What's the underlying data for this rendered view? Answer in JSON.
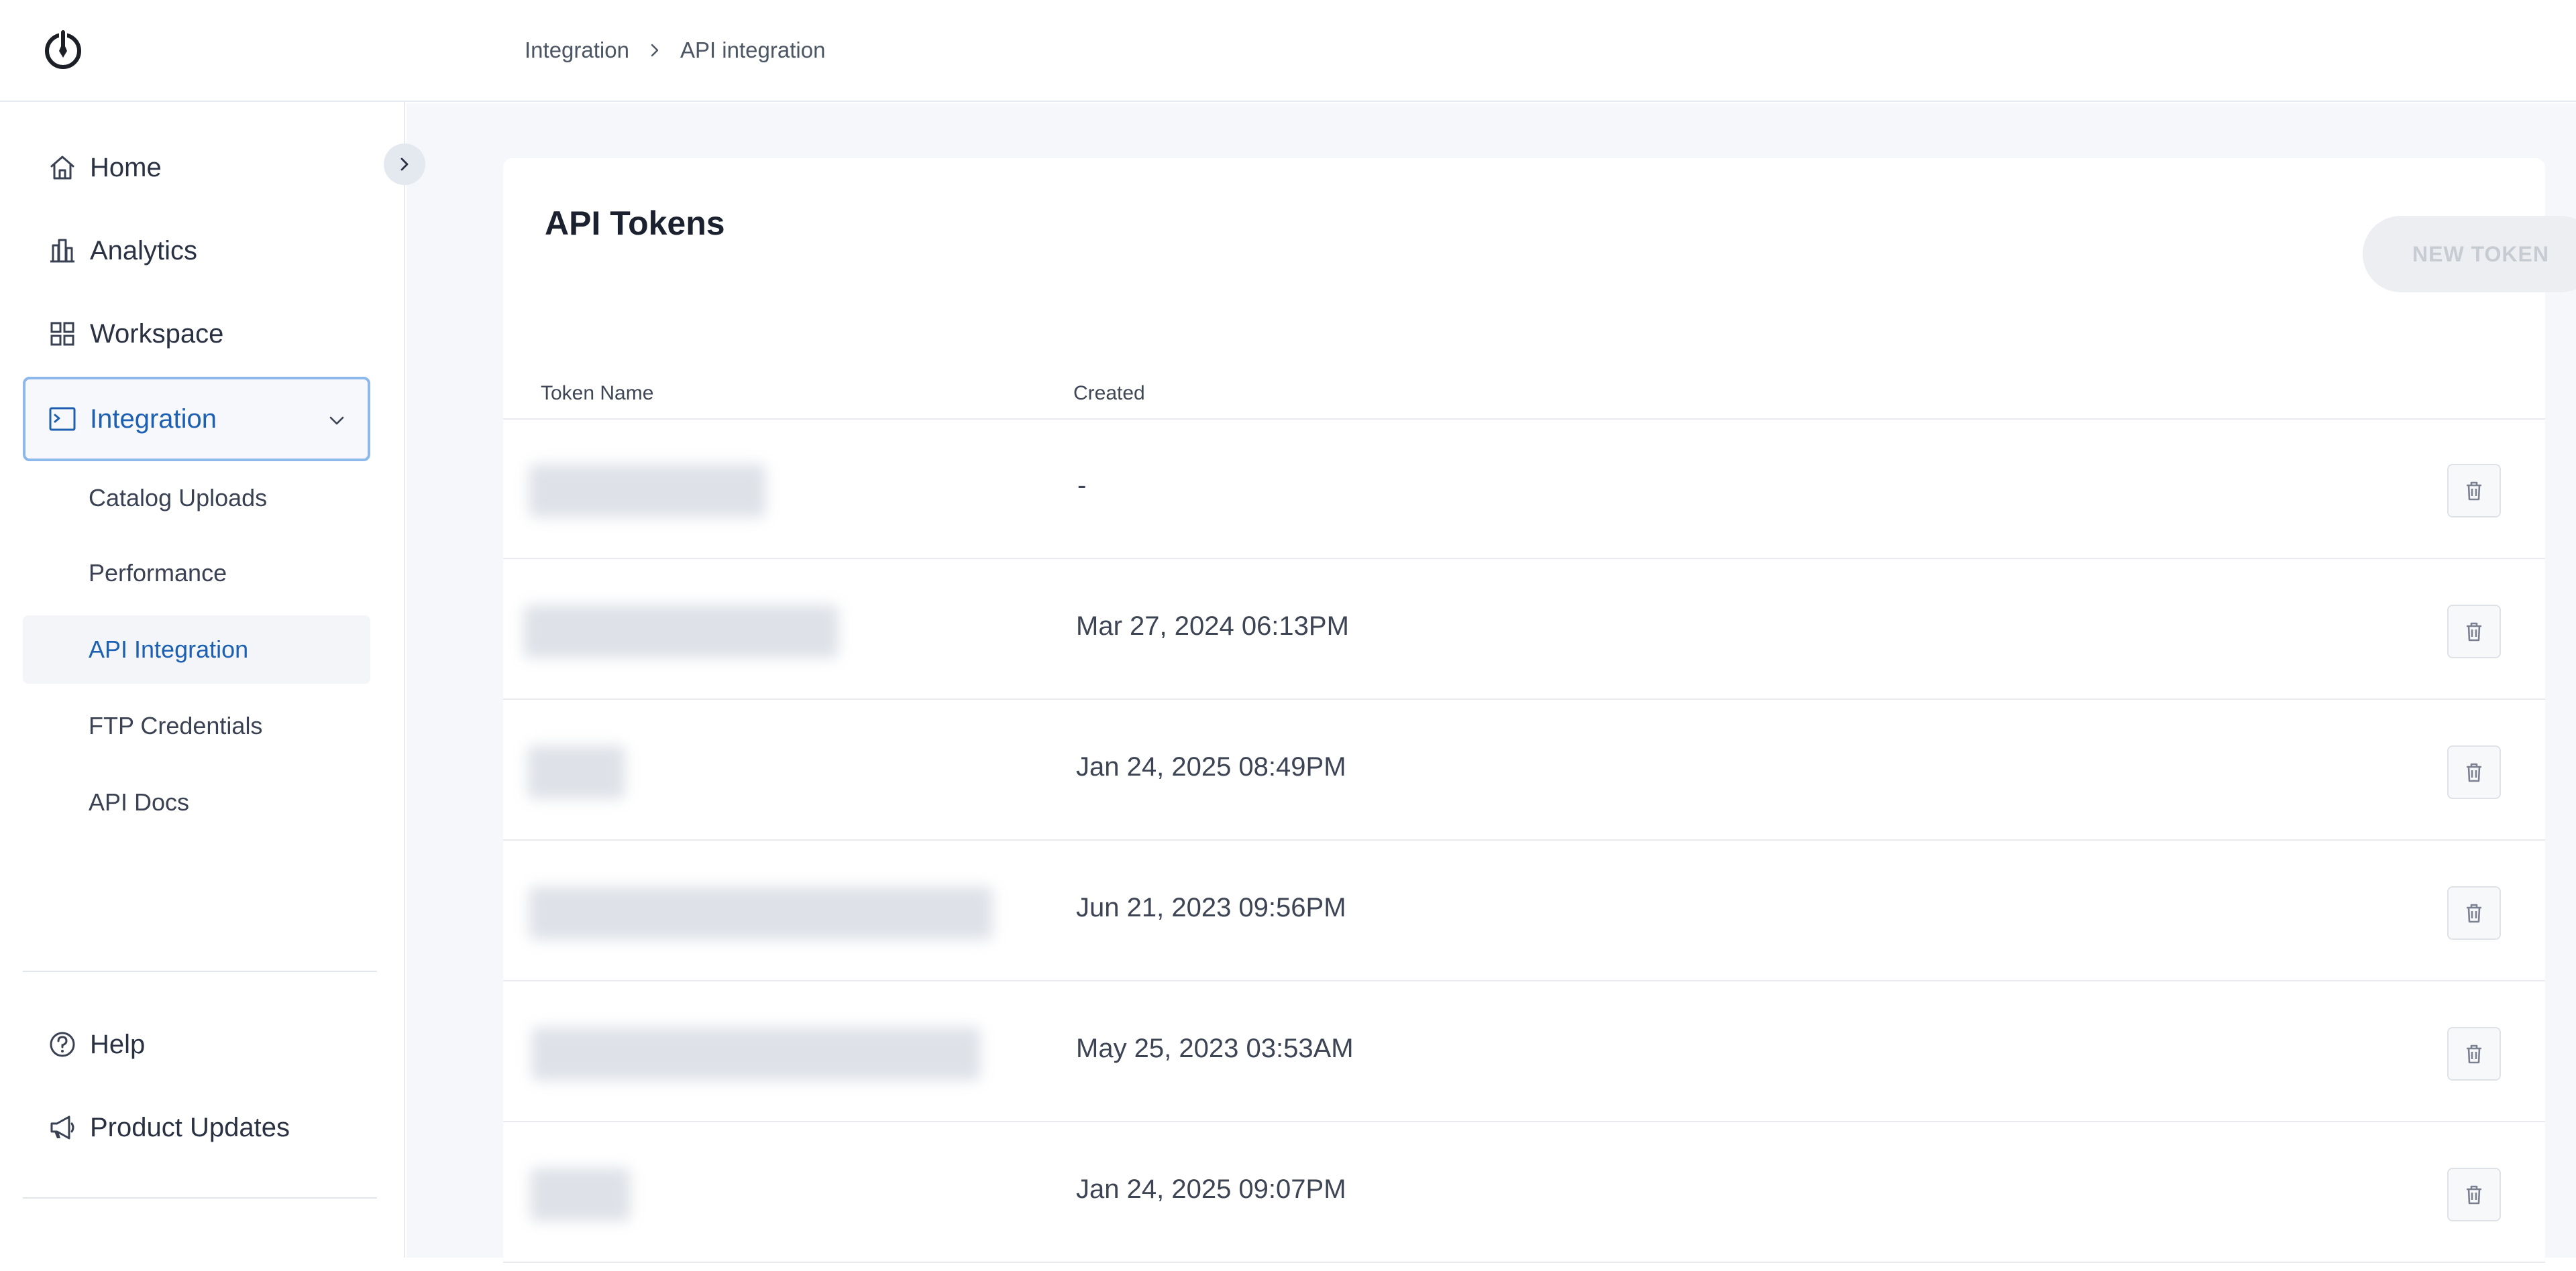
{
  "breadcrumb": {
    "items": [
      "Integration",
      "API integration"
    ]
  },
  "sidebar": {
    "items": [
      {
        "label": "Home",
        "icon": "home-icon"
      },
      {
        "label": "Analytics",
        "icon": "analytics-icon"
      },
      {
        "label": "Workspace",
        "icon": "workspace-icon"
      },
      {
        "label": "Integration",
        "icon": "integration-icon",
        "active": true
      }
    ],
    "sub_items": [
      {
        "label": "Catalog Uploads"
      },
      {
        "label": "Performance"
      },
      {
        "label": "API Integration",
        "selected": true
      },
      {
        "label": "FTP Credentials"
      },
      {
        "label": "API Docs"
      }
    ],
    "bottom_items": [
      {
        "label": "Help",
        "icon": "help-icon"
      },
      {
        "label": "Product Updates",
        "icon": "megaphone-icon"
      }
    ]
  },
  "main": {
    "title": "API Tokens",
    "new_token_label": "NEW TOKEN",
    "columns": [
      "Token Name",
      "Created"
    ],
    "rows": [
      {
        "created": "-"
      },
      {
        "created": "Mar 27, 2024 06:13PM"
      },
      {
        "created": "Jan 24, 2025 08:49PM"
      },
      {
        "created": "Jun 21, 2023 09:56PM"
      },
      {
        "created": "May 25, 2023 03:53AM"
      },
      {
        "created": "Jan 24, 2025 09:07PM"
      }
    ]
  },
  "colors": {
    "accent": "#1d5fb0",
    "active_border": "#8cb8ec",
    "background": "#f5f7fa"
  }
}
